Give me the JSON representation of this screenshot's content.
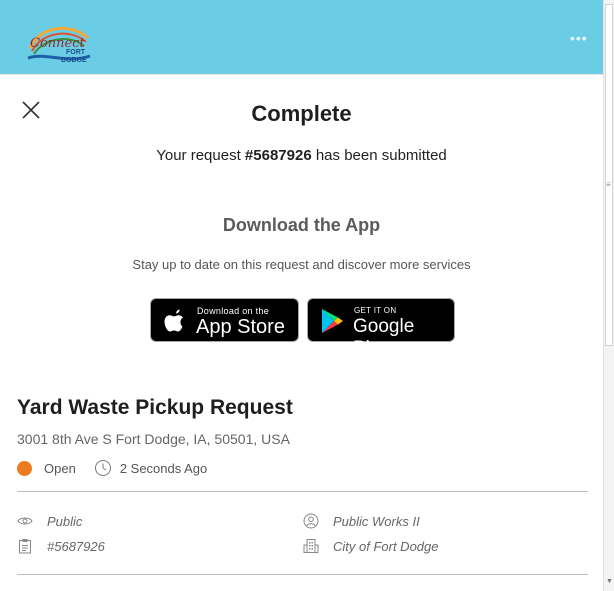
{
  "header": {
    "logo": {
      "word": "Connect",
      "line1": "FORT",
      "line2": "DODGE"
    },
    "menu_icon": "more-dots-icon",
    "bg_color": "#6bcde5"
  },
  "dialog": {
    "title": "Complete",
    "submitted_prefix": "Your request ",
    "request_number": "#5687926",
    "submitted_suffix": " has been submitted"
  },
  "download": {
    "title": "Download the App",
    "subtitle": "Stay up to date on this request and discover more services",
    "app_store": {
      "small": "Download on the",
      "big": "App Store"
    },
    "google_play": {
      "small": "GET IT ON",
      "big": "Google Play"
    }
  },
  "request": {
    "title": "Yard Waste Pickup Request",
    "address": "3001 8th Ave S Fort Dodge, IA, 50501, USA",
    "status": "Open",
    "status_color": "#ec7a1e",
    "time": "2 Seconds Ago",
    "visibility": "Public",
    "number": "#5687926",
    "department": "Public Works II",
    "organization": "City of Fort Dodge"
  }
}
